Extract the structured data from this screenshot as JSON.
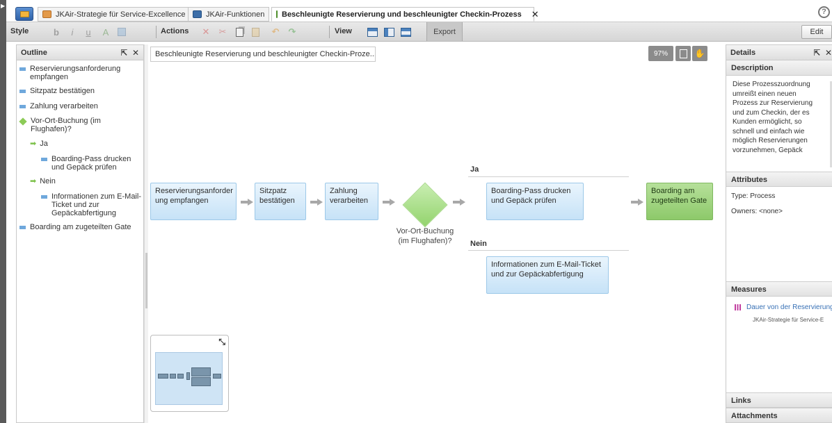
{
  "tabs": [
    {
      "label": "JKAir-Strategie für Service-Excellence",
      "active": false
    },
    {
      "label": "JKAir-Funktionen",
      "active": false
    },
    {
      "label": "Beschleunigte Reservierung und beschleunigter Checkin-Prozess",
      "active": true,
      "close": "✕"
    }
  ],
  "help_label": "?",
  "toolbar": {
    "style_label": "Style",
    "actions_label": "Actions",
    "view_label": "View",
    "export_label": "Export",
    "edit_label": "Edit"
  },
  "outline": {
    "title": "Outline",
    "items": [
      {
        "label": "Reservierungsanforderung empfangen",
        "kind": "task"
      },
      {
        "label": "Sitzpatz bestätigen",
        "kind": "task"
      },
      {
        "label": "Zahlung verarbeiten",
        "kind": "task"
      },
      {
        "label": "Vor-Ort-Buchung (im Flughafen)?",
        "kind": "decision"
      },
      {
        "label": "Ja",
        "kind": "branch"
      },
      {
        "label": "Boarding-Pass drucken und Gepäck prüfen",
        "kind": "task"
      },
      {
        "label": "Nein",
        "kind": "branch"
      },
      {
        "label": "Informationen zum E-Mail-Ticket und zur Gepäckabfertigung",
        "kind": "task"
      },
      {
        "label": "Boarding am zugeteilten Gate",
        "kind": "task"
      }
    ]
  },
  "canvas": {
    "breadcrumb": "Beschleunigte Reservierung und beschleunigter Checkin-Proze...",
    "zoom": "97%",
    "nodes": {
      "n1": "Reservierungsanforder ung empfangen",
      "n2": "Sitzpatz bestätigen",
      "n3": "Zahlung verarbeiten",
      "decision": "Vor-Ort-Buchung (im Flughafen)?",
      "ja_task": "Boarding-Pass drucken und Gepäck prüfen",
      "nein_task": "Informationen zum E-Mail-Ticket und zur Gepäckabfertigung",
      "final": "Boarding am zugeteilten Gate"
    },
    "lanes": {
      "ja": "Ja",
      "nein": "Nein"
    }
  },
  "details": {
    "title": "Details",
    "description_header": "Description",
    "description": "Diese Prozesszuordnung umreißt einen neuen Prozess zur Reservierung und zum Checkin, der es Kunden ermöglicht, so schnell und einfach wie möglich Reservierungen vorzunehmen, Gepäck",
    "attributes_header": "Attributes",
    "type_line": "Type: Process",
    "owners_line": "Owners:   <none>",
    "measures_header": "Measures",
    "measure_name": "Dauer von der Reservierung",
    "measure_source": "JKAir-Strategie für Service-E",
    "links_header": "Links",
    "attachments_header": "Attachments"
  },
  "colors": {
    "task_fill": "#c6e2f7",
    "decision_fill": "#93d36d",
    "final_fill": "#8dc96a",
    "measure_link": "#3770b5"
  }
}
